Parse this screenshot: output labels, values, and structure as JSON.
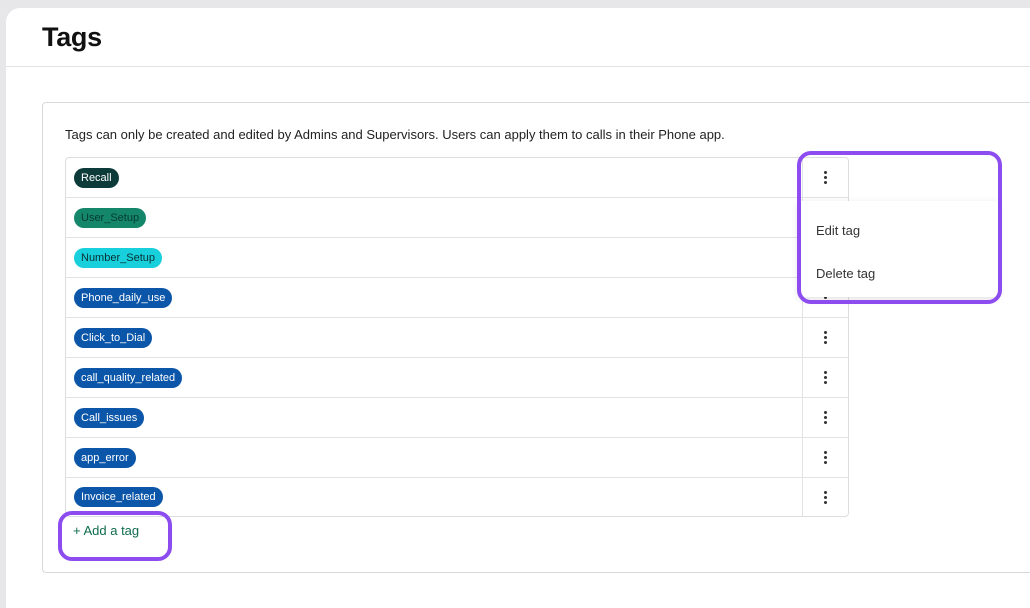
{
  "page": {
    "title": "Tags"
  },
  "card": {
    "description": "Tags can only be created and edited by Admins and Supervisors. Users can apply them to calls in their Phone app.",
    "add_tag_label": "+ Add a tag"
  },
  "tags": [
    {
      "label": "Recall",
      "color": "#0c3b3a"
    },
    {
      "label": "User_Setup",
      "color": "#14866a"
    },
    {
      "label": "Number_Setup",
      "color": "#17d0dc"
    },
    {
      "label": "Phone_daily_use",
      "color": "#0b56a8"
    },
    {
      "label": "Click_to_Dial",
      "color": "#0b56a8"
    },
    {
      "label": "call_quality_related",
      "color": "#0b56a8"
    },
    {
      "label": "Call_issues",
      "color": "#0b56a8"
    },
    {
      "label": "app_error",
      "color": "#0b56a8"
    },
    {
      "label": "Invoice_related",
      "color": "#0b56a8"
    }
  ],
  "context_menu": {
    "items": [
      "Edit tag",
      "Delete tag"
    ]
  },
  "colors": {
    "highlight": "#8c4cf0",
    "add_tag_text": "#0e6b4e"
  }
}
